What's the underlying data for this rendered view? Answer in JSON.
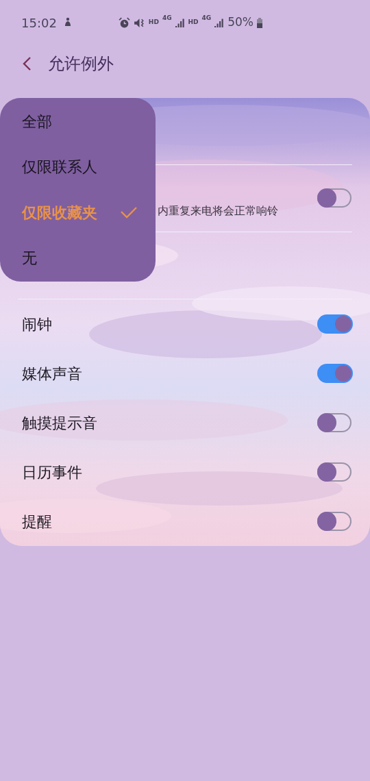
{
  "status_bar": {
    "time": "15:02",
    "hd_1": "HD",
    "network_1": "4G",
    "hd_2": "HD",
    "network_2": "4G",
    "battery": "50%"
  },
  "header": {
    "title": "允许例外"
  },
  "settings": [
    {
      "kind": "hidden"
    },
    {
      "kind": "toggle",
      "text": "内重复来电将会正常响铃",
      "on": false
    },
    {
      "kind": "hidden"
    },
    {
      "kind": "toggle",
      "text": "闹钟",
      "on": true
    },
    {
      "kind": "toggle",
      "text": "媒体声音",
      "on": true
    },
    {
      "kind": "toggle",
      "text": "触摸提示音",
      "on": false
    },
    {
      "kind": "toggle",
      "text": "日历事件",
      "on": false
    },
    {
      "kind": "toggle",
      "text": "提醒",
      "on": false
    }
  ],
  "menu": [
    {
      "label": "全部",
      "selected": false
    },
    {
      "label": "仅限联系人",
      "selected": false
    },
    {
      "label": "仅限收藏夹",
      "selected": true
    },
    {
      "label": "无",
      "selected": false
    }
  ]
}
